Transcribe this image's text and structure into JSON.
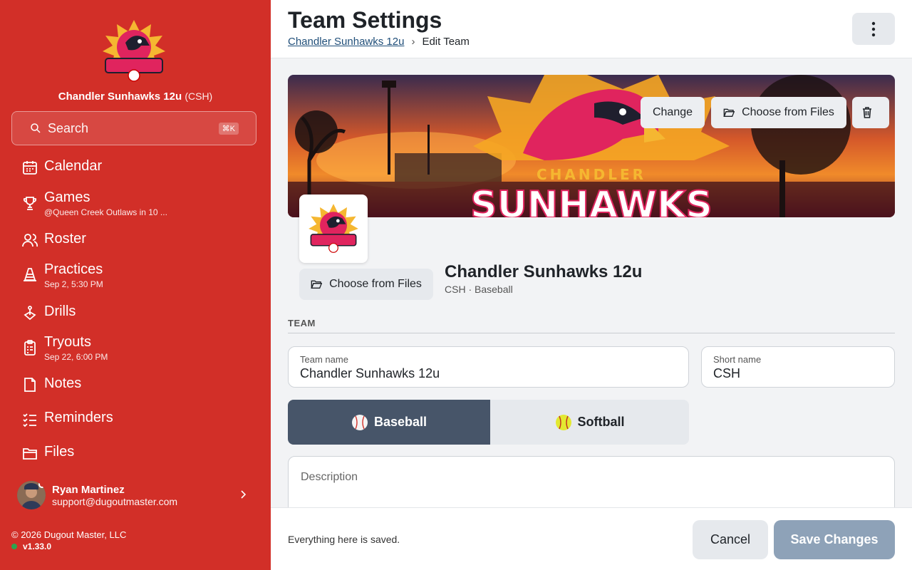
{
  "sidebar": {
    "team_name": "Chandler Sunhawks 12u",
    "team_abbr": "(CSH)",
    "search": {
      "label": "Search",
      "shortcut": "⌘K"
    },
    "nav": [
      {
        "label": "Calendar",
        "icon": "calendar-icon"
      },
      {
        "label": "Games",
        "sub": "@Queen Creek Outlaws in 10 ...",
        "icon": "trophy-icon"
      },
      {
        "label": "Roster",
        "icon": "users-icon"
      },
      {
        "label": "Practices",
        "sub": "Sep 2, 5:30 PM",
        "icon": "cone-icon"
      },
      {
        "label": "Drills",
        "icon": "drill-icon"
      },
      {
        "label": "Tryouts",
        "sub": "Sep 22, 6:00 PM",
        "icon": "clipboard-icon"
      },
      {
        "label": "Notes",
        "icon": "note-icon"
      },
      {
        "label": "Reminders",
        "icon": "checklist-icon"
      },
      {
        "label": "Files",
        "icon": "folder-icon"
      }
    ],
    "user": {
      "name": "Ryan Martinez",
      "email": "support@dugoutmaster.com"
    },
    "copyright": "© 2026 Dugout Master, LLC",
    "version": "v1.33.0"
  },
  "header": {
    "title": "Team Settings",
    "breadcrumb": {
      "parent": "Chandler Sunhawks 12u",
      "current": "Edit Team"
    }
  },
  "banner": {
    "change_label": "Change",
    "choose_files_label": "Choose from Files",
    "banner_text_top": "CHANDLER",
    "banner_text_bottom": "SUNHAWKS"
  },
  "team_card": {
    "choose_files_label": "Choose from Files",
    "name": "Chandler Sunhawks 12u",
    "meta": "CSH · Baseball"
  },
  "form": {
    "section": "TEAM",
    "team_name": {
      "label": "Team name",
      "value": "Chandler Sunhawks 12u"
    },
    "short_name": {
      "label": "Short name",
      "value": "CSH"
    },
    "sports": [
      {
        "label": "Baseball",
        "selected": true
      },
      {
        "label": "Softball",
        "selected": false
      }
    ],
    "description": {
      "placeholder": "Description"
    }
  },
  "bottombar": {
    "status": "Everything here is saved.",
    "cancel": "Cancel",
    "save": "Save Changes"
  },
  "colors": {
    "sidebar": "#d22f28",
    "selected_sport": "#475569",
    "save_button": "#8ea2b8"
  }
}
